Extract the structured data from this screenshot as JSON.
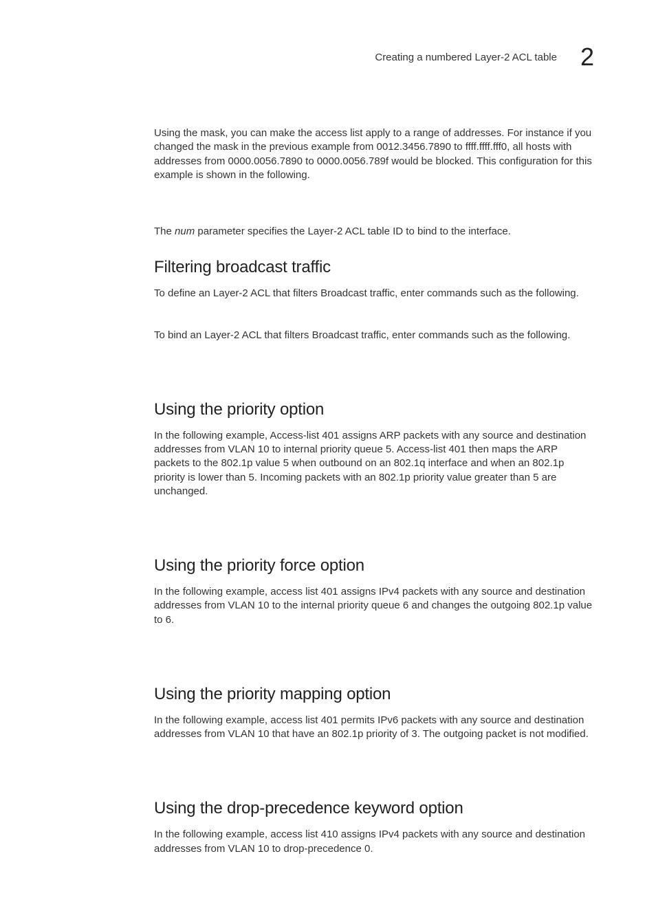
{
  "header": {
    "running_title": "Creating a numbered Layer-2 ACL table",
    "chapter_number": "2"
  },
  "intro": {
    "paragraph": "Using the mask, you can make the access list apply to a range of addresses. For instance if you changed the mask in the previous example from 0012.3456.7890 to ffff.ffff.fff0, all hosts with addresses from 0000.0056.7890 to 0000.0056.789f would be blocked. This configuration for this example is shown in the following."
  },
  "num_param": {
    "prefix": "The ",
    "param": "num",
    "suffix": " parameter specifies the Layer-2 ACL table ID to bind to the interface."
  },
  "sections": {
    "filtering": {
      "heading": "Filtering broadcast traffic",
      "para1": "To define an Layer-2 ACL that filters Broadcast traffic, enter commands such as the following.",
      "para2": "To bind an Layer-2 ACL that filters Broadcast traffic, enter commands such as the following."
    },
    "priority": {
      "heading": "Using the priority option",
      "para": "In the following example, Access-list 401 assigns ARP packets with any source and destination addresses from VLAN 10 to internal priority queue 5. Access-list 401 then maps the ARP packets to the 802.1p value 5 when outbound on an 802.1q interface and when an 802.1p priority is lower than 5. Incoming packets with an 802.1p priority value greater than 5 are unchanged."
    },
    "priority_force": {
      "heading": "Using the priority force option",
      "para": "In the following example, access list 401 assigns IPv4 packets with any source and destination addresses from VLAN 10 to the internal priority queue 6 and changes the outgoing 802.1p value to 6."
    },
    "priority_mapping": {
      "heading": "Using the priority mapping option",
      "para": "In the following example, access list 401 permits IPv6 packets with any source and destination addresses from VLAN 10 that have an 802.1p priority of 3. The outgoing packet is not modified."
    },
    "drop_precedence": {
      "heading": "Using the drop-precedence keyword option",
      "para": "In the following example, access list 410 assigns IPv4 packets with any source and destination addresses from VLAN 10 to drop-precedence 0."
    }
  }
}
